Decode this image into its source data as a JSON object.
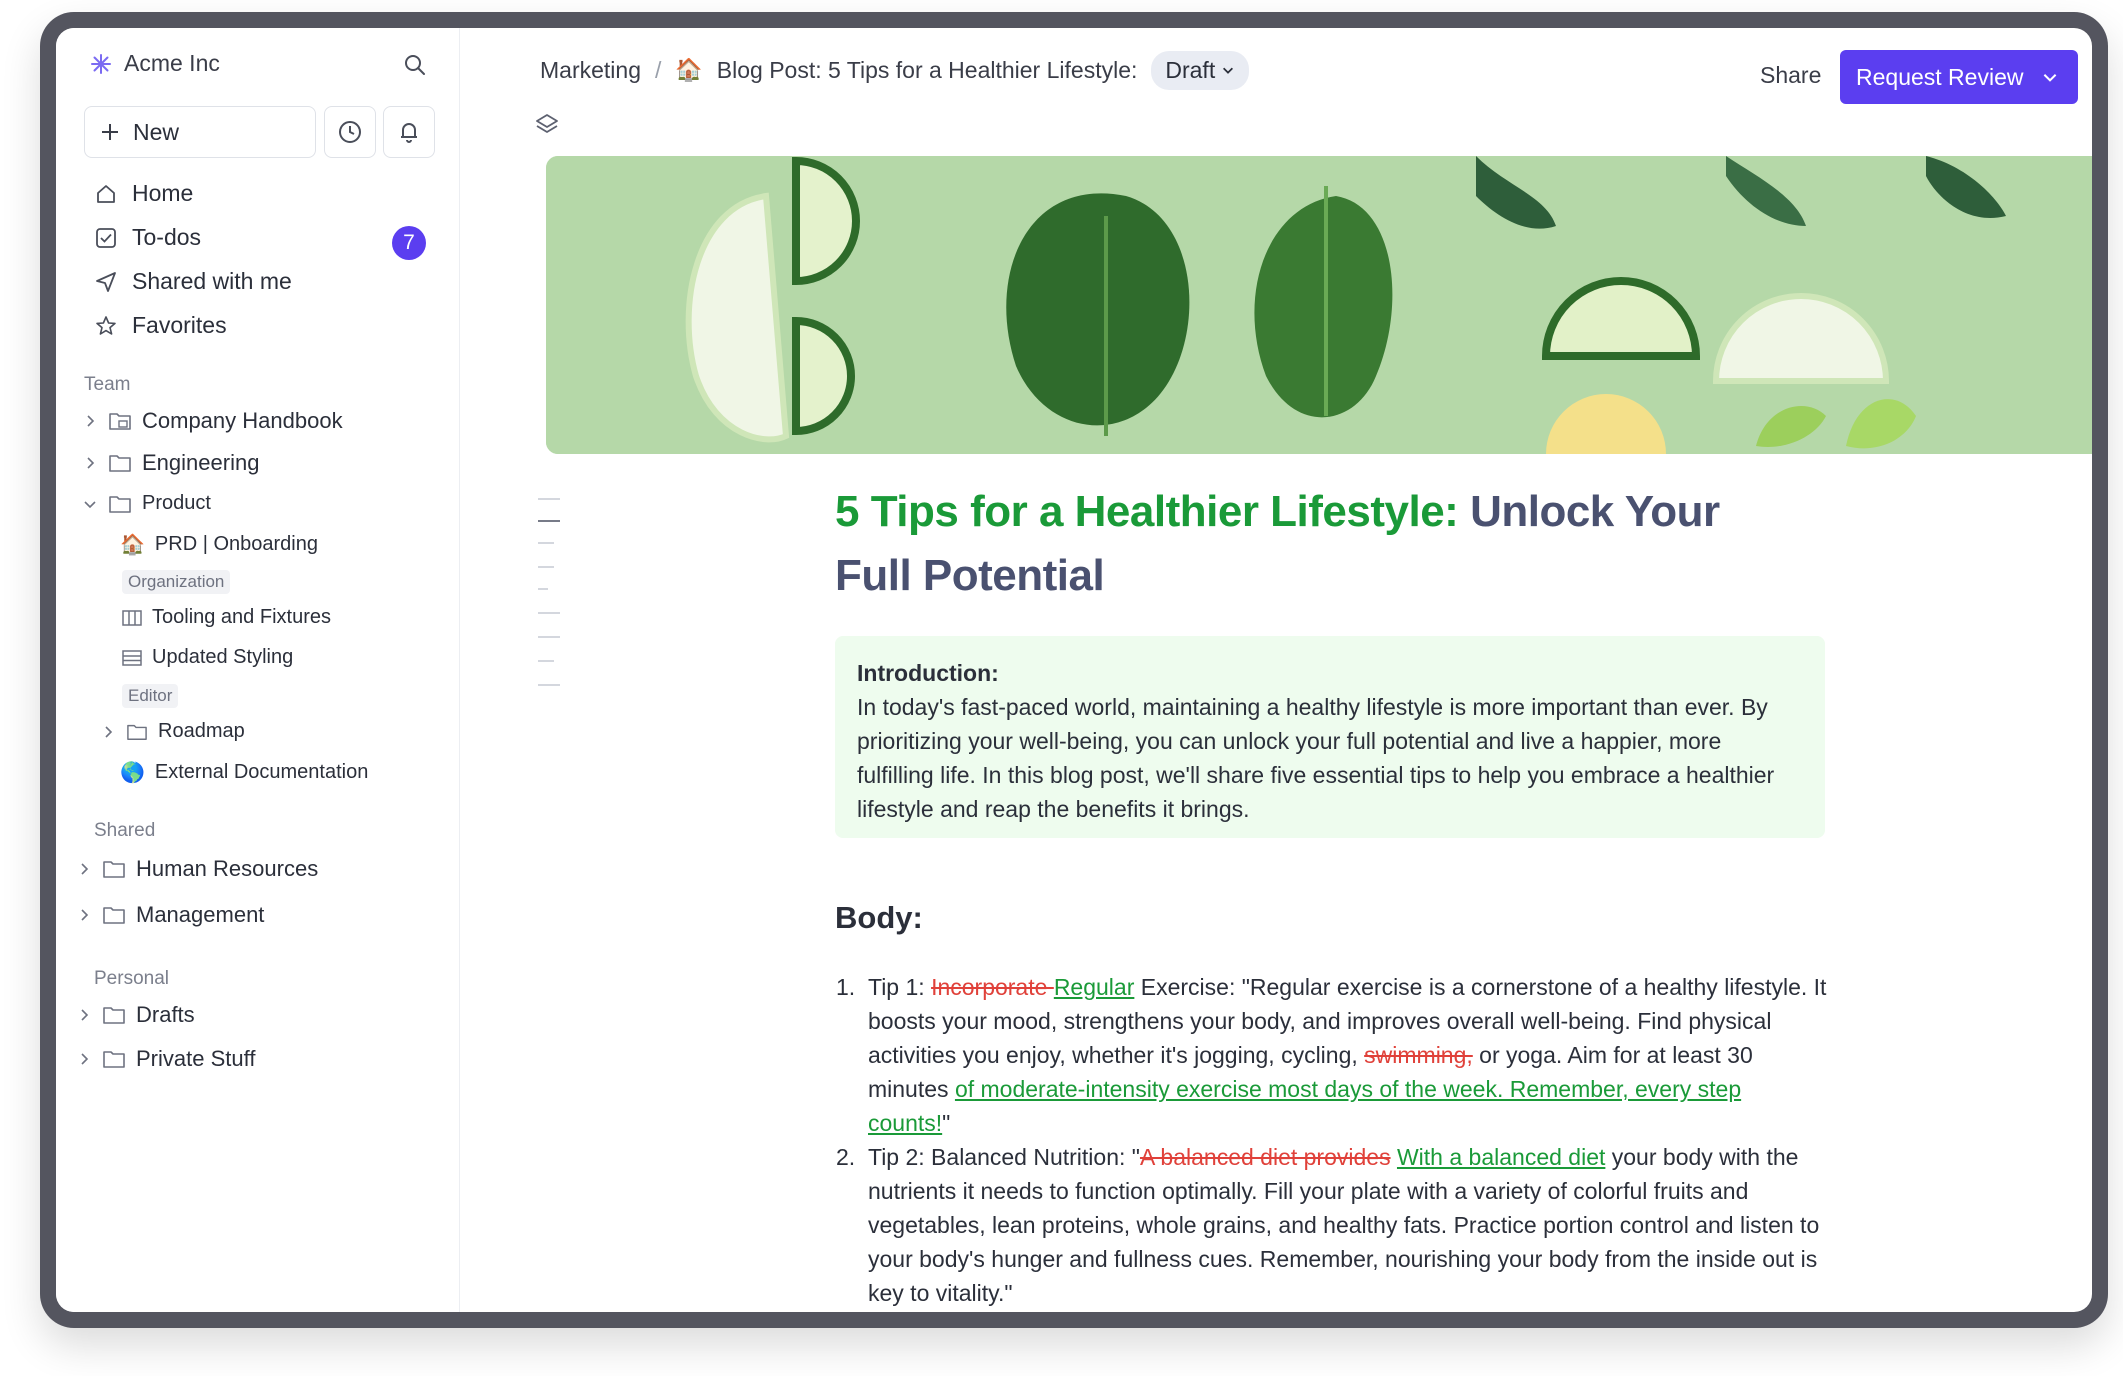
{
  "sidebar": {
    "workspace_name": "Acme Inc",
    "new_label": "New",
    "nav": [
      {
        "label": "Home"
      },
      {
        "label": "To-dos"
      },
      {
        "label": "Shared with me"
      },
      {
        "label": "Favorites"
      }
    ],
    "todo_count": "7",
    "team_label": "Team",
    "team_items": {
      "company_handbook": "Company Handbook",
      "engineering": "Engineering",
      "product": "Product",
      "prd_onboarding": "PRD | Onboarding",
      "organization_tag": "Organization",
      "tooling": "Tooling and Fixtures",
      "updated_styling": "Updated Styling",
      "editor_tag": "Editor",
      "roadmap": "Roadmap",
      "external_docs": "External Documentation"
    },
    "shared_label": "Shared",
    "shared_items": [
      "Human Resources",
      "Management"
    ],
    "personal_label": "Personal",
    "personal_items": [
      "Drafts",
      "Private Stuff"
    ]
  },
  "header": {
    "breadcrumb_parent": "Marketing",
    "doc_title": "Blog Post: 5 Tips for a Healthier Lifestyle:",
    "status": "Draft",
    "share_label": "Share",
    "request_review_label": "Request Review"
  },
  "article": {
    "title_green": "5 Tips for a Healthier Lifestyle:",
    "title_rest": "Unlock Your Full Potential",
    "intro_heading": "Introduction:",
    "intro_text": "In today's fast-paced world, maintaining a healthy lifestyle is more important than ever. By prioritizing your well-being, you can unlock your full potential and live a happier, more fulfilling life. In this blog post, we'll share five essential tips to help you embrace a healthier lifestyle and reap the benefits it brings.",
    "body_heading": "Body:",
    "tip1": {
      "num": "1.",
      "a": "Tip 1: ",
      "del1": "Incorporate ",
      "ins1": "Regular",
      "b": " Exercise: \"Regular exercise is a cornerstone of a healthy lifestyle. It boosts your mood, strengthens your body, and improves overall well-being. Find physical activities you enjoy, whether it's jogging, cycling, ",
      "del2": "swimming,",
      "c": " or yoga. Aim for at least 30 minutes ",
      "ins2": "of moderate-intensity exercise most days of the week. Remember, every step counts!",
      "d": "\""
    },
    "tip2": {
      "num": "2.",
      "a": "Tip 2: Balanced Nutrition: \"",
      "del1": "A balanced diet provides",
      "ins1": "With a balanced diet",
      "b": " your body with the nutrients it needs to function optimally. Fill your plate with a variety of colorful fruits and vegetables, lean proteins, whole grains, and healthy fats. Practice portion control and listen to your body's hunger and fullness cues. Remember, nourishing your body from the inside out is key to vitality.\""
    }
  },
  "colors": {
    "accent": "#5b3ef0",
    "insert_green": "#1a9a38",
    "delete_red": "#e0413a",
    "intro_bg": "#eefcee"
  },
  "icons": [
    "workspace-logo-icon",
    "search-icon",
    "plus-icon",
    "clock-icon",
    "bell-icon",
    "home-icon",
    "checkbox-icon",
    "send-icon",
    "star-icon",
    "folder-icon",
    "chevron-right-icon",
    "chevron-down-icon",
    "layers-icon"
  ]
}
